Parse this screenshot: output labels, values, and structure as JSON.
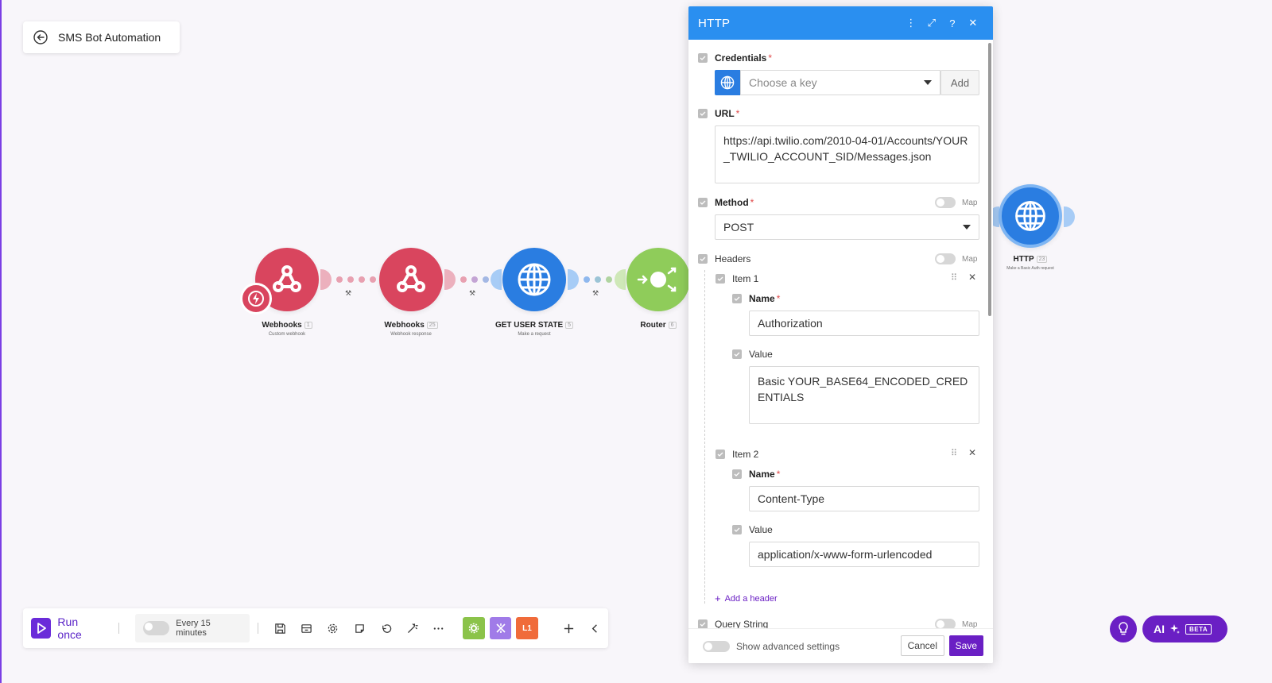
{
  "scenario": {
    "title": "SMS Bot Automation"
  },
  "modules": [
    {
      "name": "Webhooks",
      "badge": "1",
      "subtitle": "Custom webhook"
    },
    {
      "name": "Webhooks",
      "badge": "25",
      "subtitle": "Webhook response"
    },
    {
      "name": "GET USER STATE",
      "badge": "5",
      "subtitle": "Make a request"
    },
    {
      "name": "Router",
      "badge": "6",
      "subtitle": ""
    },
    {
      "name": "HTTP",
      "badge": "23",
      "subtitle": "Make a Basic Auth request"
    }
  ],
  "panel": {
    "title": "HTTP",
    "credentials": {
      "label": "Credentials",
      "placeholder": "Choose a key",
      "add_label": "Add"
    },
    "url": {
      "label": "URL",
      "value": "https://api.twilio.com/2010-04-01/Accounts/YOUR_TWILIO_ACCOUNT_SID/Messages.json"
    },
    "method": {
      "label": "Method",
      "value": "POST",
      "map_label": "Map"
    },
    "headers": {
      "label": "Headers",
      "map_label": "Map",
      "items": [
        {
          "label": "Item 1",
          "name_label": "Name",
          "name_value": "Authorization",
          "value_label": "Value",
          "value": "Basic YOUR_BASE64_ENCODED_CREDENTIALS"
        },
        {
          "label": "Item 2",
          "name_label": "Name",
          "name_value": "Content-Type",
          "value_label": "Value",
          "value": "application/x-www-form-urlencoded"
        }
      ],
      "add_label": "Add a header"
    },
    "query_string": {
      "label": "Query String",
      "map_label": "Map"
    },
    "footer": {
      "advanced_label": "Show advanced settings",
      "cancel_label": "Cancel",
      "save_label": "Save"
    }
  },
  "toolbar": {
    "run_label": "Run once",
    "schedule_label": "Every 15 minutes",
    "square3_label": "L1"
  },
  "ai": {
    "label": "AI",
    "beta_label": "BETA"
  },
  "colors": {
    "accent": "#6a1fc4",
    "panel_header": "#2a8ff0",
    "webhook": "#d9455e",
    "http": "#2a7de1",
    "router": "#8fcc5a"
  }
}
